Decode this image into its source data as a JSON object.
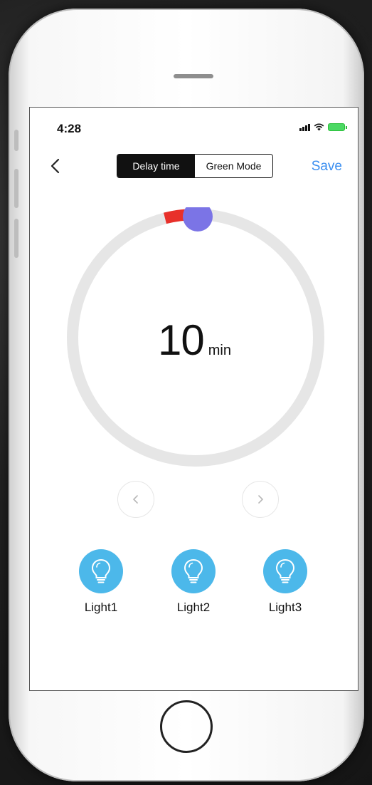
{
  "status_bar": {
    "time": "4:28"
  },
  "nav": {
    "back_icon": "chevron-left-icon",
    "tabs": [
      {
        "label": "Delay time",
        "active": true
      },
      {
        "label": "Green Mode",
        "active": false
      }
    ],
    "save_label": "Save"
  },
  "dial": {
    "value": "10",
    "unit": "min",
    "track_color": "#e6e6e6",
    "progress_color": "#e8302a",
    "knob_color": "#7b74e6"
  },
  "steppers": {
    "prev_icon": "chevron-left-icon",
    "next_icon": "chevron-right-icon"
  },
  "lights": [
    {
      "label": "Light1",
      "icon": "lightbulb-icon"
    },
    {
      "label": "Light2",
      "icon": "lightbulb-icon"
    },
    {
      "label": "Light3",
      "icon": "lightbulb-icon"
    }
  ],
  "colors": {
    "accent": "#3a8ef0",
    "light_icon_bg": "#4cb8ea"
  }
}
